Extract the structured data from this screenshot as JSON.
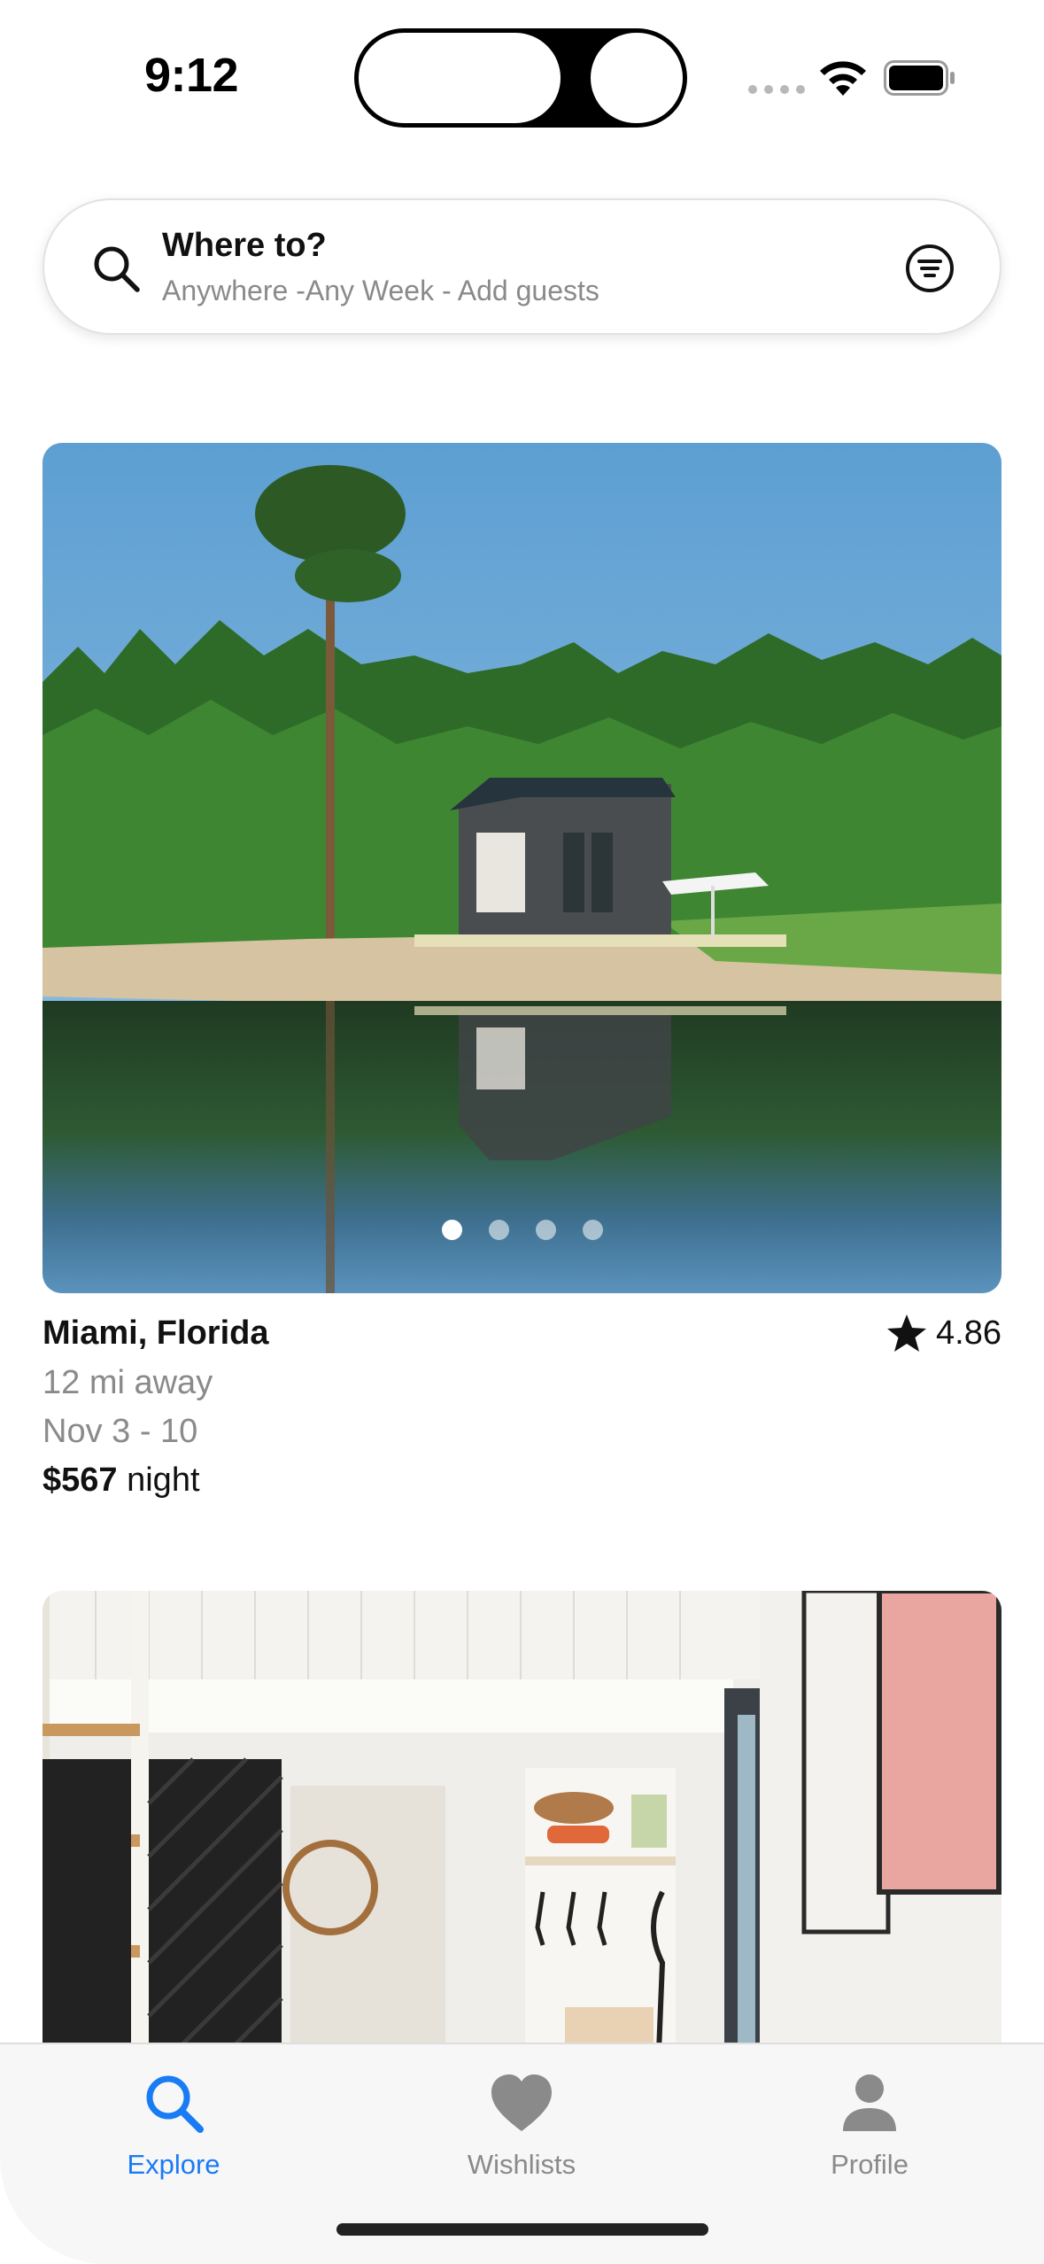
{
  "status_bar": {
    "time": "9:12"
  },
  "search": {
    "title": "Where to?",
    "subtitle": "Anywhere -Any Week - Add guests",
    "search_icon": "magnifying-glass-icon",
    "filter_icon": "filter-lines-icon"
  },
  "listings": [
    {
      "location": "Miami, Florida",
      "rating": "4.86",
      "distance": "12 mi away",
      "dates": "Nov 3 - 10",
      "price": "$567",
      "price_unit": "night",
      "image_count": 4,
      "active_image_index": 0
    }
  ],
  "tab_bar": {
    "tabs": [
      {
        "label": "Explore",
        "icon": "search-icon",
        "active": true
      },
      {
        "label": "Wishlists",
        "icon": "heart-icon",
        "active": false
      },
      {
        "label": "Profile",
        "icon": "person-icon",
        "active": false
      }
    ]
  },
  "colors": {
    "accent": "#1a7cf5",
    "secondary_text": "#8a8a8a",
    "inactive_icon": "#8a8a8a"
  }
}
